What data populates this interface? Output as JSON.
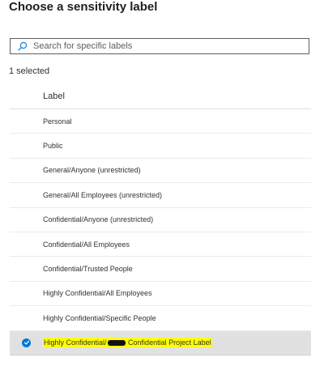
{
  "title": "Choose a sensitivity label",
  "search": {
    "placeholder": "Search for specific labels",
    "icon": "search-icon"
  },
  "selected_count": "1 selected",
  "table": {
    "header": "Label",
    "rows": [
      {
        "label": "Personal",
        "selected": false
      },
      {
        "label": "Public",
        "selected": false
      },
      {
        "label": "General/Anyone (unrestricted)",
        "selected": false
      },
      {
        "label": "General/All Employees (unrestricted)",
        "selected": false
      },
      {
        "label": "Confidential/Anyone (unrestricted)",
        "selected": false
      },
      {
        "label": "Confidential/All Employees",
        "selected": false
      },
      {
        "label": "Confidential/Trusted People",
        "selected": false
      },
      {
        "label": "Highly Confidential/All Employees",
        "selected": false
      },
      {
        "label": "Highly Confidential/Specific People",
        "selected": false
      },
      {
        "label_prefix": "Highly Confidential/",
        "label_suffix": " Confidential Project Label",
        "selected": true
      }
    ]
  },
  "colors": {
    "accent": "#0078d4",
    "selected_row_bg": "#e1e1e1",
    "highlight": "#ffff00"
  }
}
